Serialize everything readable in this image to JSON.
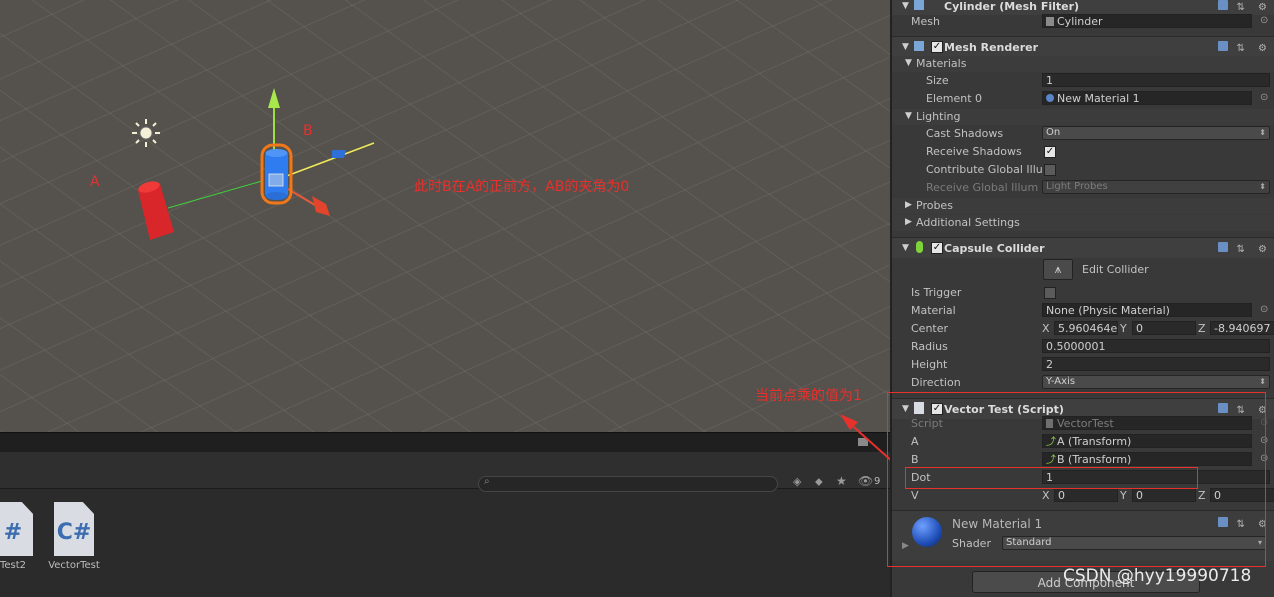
{
  "scene": {
    "label_a": "A",
    "label_b": "B",
    "annotation_main": "此时B在A的正前方，AB的夹角为0",
    "annotation_dot": "当前点乘的值为1"
  },
  "project": {
    "files": [
      {
        "name": "Test2",
        "glyph": "#"
      },
      {
        "name": "VectorTest",
        "glyph": "C#"
      }
    ],
    "hidden_count": "9"
  },
  "inspector": {
    "mesh_filter": {
      "title": "Cylinder (Mesh Filter)",
      "mesh_label": "Mesh",
      "mesh_value": "Cylinder"
    },
    "mesh_renderer": {
      "title": "Mesh Renderer",
      "materials_label": "Materials",
      "size_label": "Size",
      "size_value": "1",
      "element0_label": "Element 0",
      "element0_value": "New Material 1",
      "lighting_label": "Lighting",
      "cast_shadows_label": "Cast Shadows",
      "cast_shadows_value": "On",
      "receive_shadows_label": "Receive Shadows",
      "contribute_gi_label": "Contribute Global Illu",
      "receive_gi_label": "Receive Global Illum",
      "receive_gi_value": "Light Probes",
      "probes_label": "Probes",
      "additional_label": "Additional Settings"
    },
    "capsule_collider": {
      "title": "Capsule Collider",
      "edit_collider": "Edit Collider",
      "is_trigger_label": "Is Trigger",
      "material_label": "Material",
      "material_value": "None (Physic Material)",
      "center_label": "Center",
      "center_x": "5.960464e",
      "center_y": "0",
      "center_z": "-8.940697",
      "radius_label": "Radius",
      "radius_value": "0.5000001",
      "height_label": "Height",
      "height_value": "2",
      "direction_label": "Direction",
      "direction_value": "Y-Axis"
    },
    "vector_test": {
      "title": "Vector Test (Script)",
      "script_label": "Script",
      "script_value": "VectorTest",
      "a_label": "A",
      "a_value": "A (Transform)",
      "b_label": "B",
      "b_value": "B (Transform)",
      "dot_label": "Dot",
      "dot_value": "1",
      "v_label": "V",
      "v_x": "0",
      "v_y": "0",
      "v_z": "0"
    },
    "material": {
      "name": "New Material 1",
      "shader_label": "Shader",
      "shader_value": "Standard"
    },
    "add_component": "Add Component",
    "axis_x": "X",
    "axis_y": "Y",
    "axis_z": "Z"
  },
  "watermark": "CSDN @hyy19990718",
  "colors": {
    "annotation_red": "#e8302c",
    "inspector_bg": "#393939",
    "scene_bg": "#55514c"
  }
}
